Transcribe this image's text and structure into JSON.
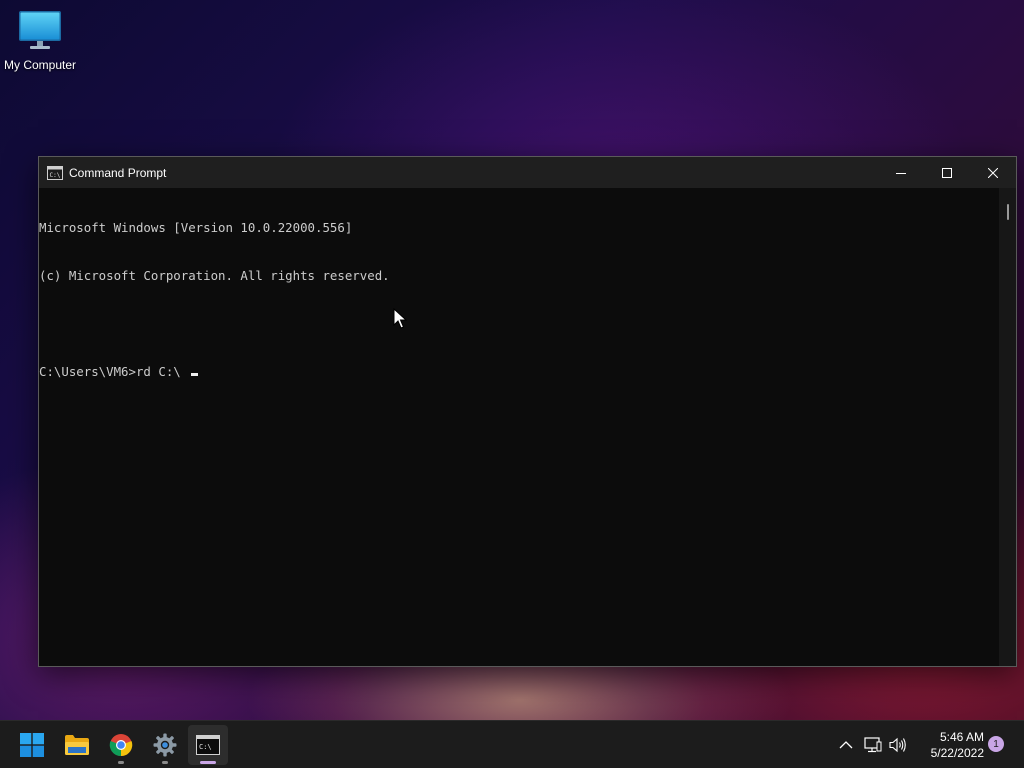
{
  "desktop": {
    "icons": [
      {
        "label": "My Computer",
        "icon": "monitor-icon"
      }
    ]
  },
  "window": {
    "title": "Command Prompt",
    "controls": {
      "minimize": "minimize-icon",
      "maximize": "maximize-icon",
      "close": "close-icon"
    },
    "console_lines": [
      "Microsoft Windows [Version 10.0.22000.556]",
      "(c) Microsoft Corporation. All rights reserved.",
      "",
      "C:\\Users\\VM6>rd C:\\ "
    ]
  },
  "taskbar": {
    "apps": [
      {
        "name": "Start",
        "icon": "windows-start-icon"
      },
      {
        "name": "File Explorer",
        "icon": "folder-icon"
      },
      {
        "name": "Google Chrome",
        "icon": "chrome-icon"
      },
      {
        "name": "Settings",
        "icon": "gear-icon"
      },
      {
        "name": "Command Prompt",
        "icon": "terminal-icon",
        "active": true
      }
    ],
    "tray": {
      "icons": [
        "chevron-up-icon",
        "network-icon",
        "volume-icon"
      ],
      "time": "5:46 AM",
      "date": "5/22/2022",
      "notification_count": "1"
    }
  },
  "colors": {
    "accent": "#c9a6e6",
    "console_bg": "#0c0c0c",
    "console_fg": "#cccccc",
    "titlebar_bg": "#1f1f1f",
    "taskbar_bg": "#1c1c1c"
  }
}
